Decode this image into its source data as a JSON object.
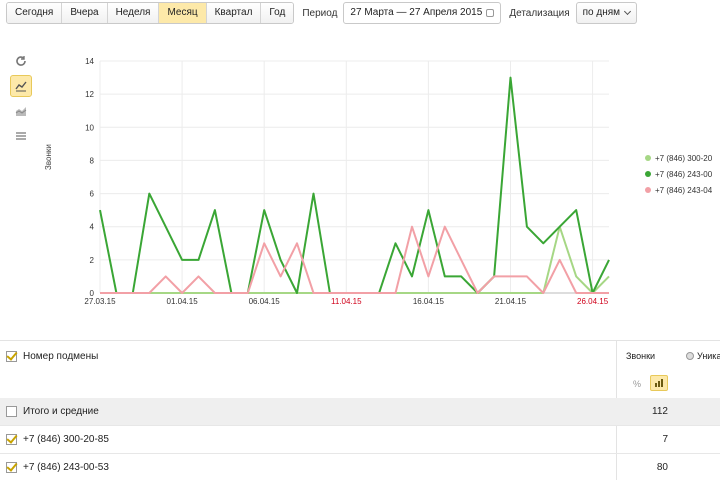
{
  "toolbar": {
    "periods": [
      "Сегодня",
      "Вчера",
      "Неделя",
      "Месяц",
      "Квартал",
      "Год"
    ],
    "active_period": "Месяц",
    "period_label": "Период",
    "period_value": "27 Марта — 27 Апреля 2015",
    "detail_label": "Детализация",
    "detail_value": "по дням"
  },
  "chart_tools": [
    "refresh-icon",
    "line-chart-icon",
    "area-chart-icon",
    "bar-chart-icon"
  ],
  "chart_data": {
    "type": "line",
    "ylabel": "Звонки",
    "ylim": [
      0,
      14
    ],
    "yticks": [
      0,
      2,
      4,
      6,
      8,
      10,
      12,
      14
    ],
    "x": [
      "27.03.15",
      "28.03.15",
      "29.03.15",
      "30.03.15",
      "31.03.15",
      "01.04.15",
      "02.04.15",
      "03.04.15",
      "04.04.15",
      "05.04.15",
      "06.04.15",
      "07.04.15",
      "08.04.15",
      "09.04.15",
      "10.04.15",
      "11.04.15",
      "12.04.15",
      "13.04.15",
      "14.04.15",
      "15.04.15",
      "16.04.15",
      "17.04.15",
      "18.04.15",
      "19.04.15",
      "20.04.15",
      "21.04.15",
      "22.04.15",
      "23.04.15",
      "24.04.15",
      "25.04.15",
      "26.04.15",
      "27.04.15"
    ],
    "xtick_labels": [
      {
        "label": "27.03.15",
        "index": 0,
        "weekend": false
      },
      {
        "label": "01.04.15",
        "index": 5,
        "weekend": false
      },
      {
        "label": "06.04.15",
        "index": 10,
        "weekend": false
      },
      {
        "label": "11.04.15",
        "index": 15,
        "weekend": true
      },
      {
        "label": "16.04.15",
        "index": 20,
        "weekend": false
      },
      {
        "label": "21.04.15",
        "index": 25,
        "weekend": false
      },
      {
        "label": "26.04.15",
        "index": 30,
        "weekend": true
      }
    ],
    "series": [
      {
        "name": "+7 (846) 300-20-85",
        "color": "#a6d785",
        "values": [
          0,
          0,
          0,
          0,
          0,
          0,
          0,
          0,
          0,
          0,
          0,
          0,
          0,
          0,
          0,
          0,
          0,
          0,
          0,
          0,
          0,
          0,
          0,
          0,
          0,
          0,
          0,
          0,
          4,
          1,
          0,
          1
        ]
      },
      {
        "name": "+7 (846) 243-00-53",
        "color": "#3aa635",
        "values": [
          5,
          0,
          0,
          6,
          4,
          2,
          2,
          5,
          0,
          0,
          5,
          2,
          0,
          6,
          0,
          0,
          0,
          0,
          3,
          1,
          5,
          1,
          1,
          0,
          1,
          13,
          4,
          3,
          4,
          5,
          0,
          2
        ]
      },
      {
        "name": "+7 (846) 243-04",
        "color": "#f2a0a6",
        "values": [
          0,
          0,
          0,
          0,
          1,
          0,
          1,
          0,
          0,
          0,
          3,
          1,
          3,
          0,
          0,
          0,
          0,
          0,
          0,
          4,
          1,
          4,
          2,
          0,
          1,
          1,
          1,
          0,
          2,
          0,
          0,
          0
        ]
      }
    ],
    "legend_placement": "right",
    "grid": true
  },
  "legend": [
    {
      "label": "+7 (846) 300-20",
      "color": "#a6d785"
    },
    {
      "label": "+7 (846) 243-00",
      "color": "#3aa635"
    },
    {
      "label": "+7 (846) 243-04",
      "color": "#f2a0a6"
    }
  ],
  "table": {
    "header_label": "Номер подмены",
    "col_calls": "Звонки",
    "col_unique": "Уника",
    "pct_label": "%",
    "rows": [
      {
        "label": "Итого и средние",
        "calls": "112",
        "checked": false,
        "totals": true
      },
      {
        "label": "+7 (846) 300-20-85",
        "calls": "7",
        "checked": true,
        "totals": false
      },
      {
        "label": "+7 (846) 243-00-53",
        "calls": "80",
        "checked": true,
        "totals": false
      }
    ]
  }
}
